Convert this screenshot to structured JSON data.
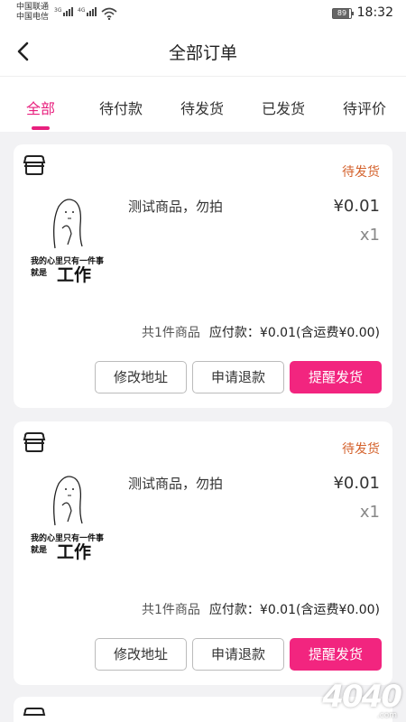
{
  "status_bar": {
    "carrier_1": "中国联通",
    "carrier_2": "中国电信",
    "net_1": "3G",
    "net_2": "4G",
    "battery": "89",
    "time": "18:32"
  },
  "header": {
    "title": "全部订单",
    "back_icon": "chevron-left-icon"
  },
  "tabs": [
    {
      "label": "全部",
      "active": true
    },
    {
      "label": "待付款",
      "active": false
    },
    {
      "label": "待发货",
      "active": false
    },
    {
      "label": "已发货",
      "active": false
    },
    {
      "label": "待评价",
      "active": false
    }
  ],
  "orders": [
    {
      "shop_icon": "store-icon",
      "status": "待发货",
      "thumb_line1": "我的心里只有一件事",
      "thumb_line2": "就是",
      "thumb_big": "工作",
      "product_name": "测试商品，勿拍",
      "price": "¥0.01",
      "qty": "x1",
      "item_count": "共1件商品",
      "payable": "应付款：¥0.01(含运费¥0.00)",
      "btn_address": "修改地址",
      "btn_refund": "申请退款",
      "btn_remind": "提醒发货"
    },
    {
      "shop_icon": "store-icon",
      "status": "待发货",
      "thumb_line1": "我的心里只有一件事",
      "thumb_line2": "就是",
      "thumb_big": "工作",
      "product_name": "测试商品，勿拍",
      "price": "¥0.01",
      "qty": "x1",
      "item_count": "共1件商品",
      "payable": "应付款：¥0.01(含运费¥0.00)",
      "btn_address": "修改地址",
      "btn_refund": "申请退款",
      "btn_remind": "提醒发货"
    }
  ],
  "watermark": {
    "text": "4040",
    "sub": ".com"
  },
  "colors": {
    "accent": "#f2257f",
    "status": "#d4622c"
  }
}
